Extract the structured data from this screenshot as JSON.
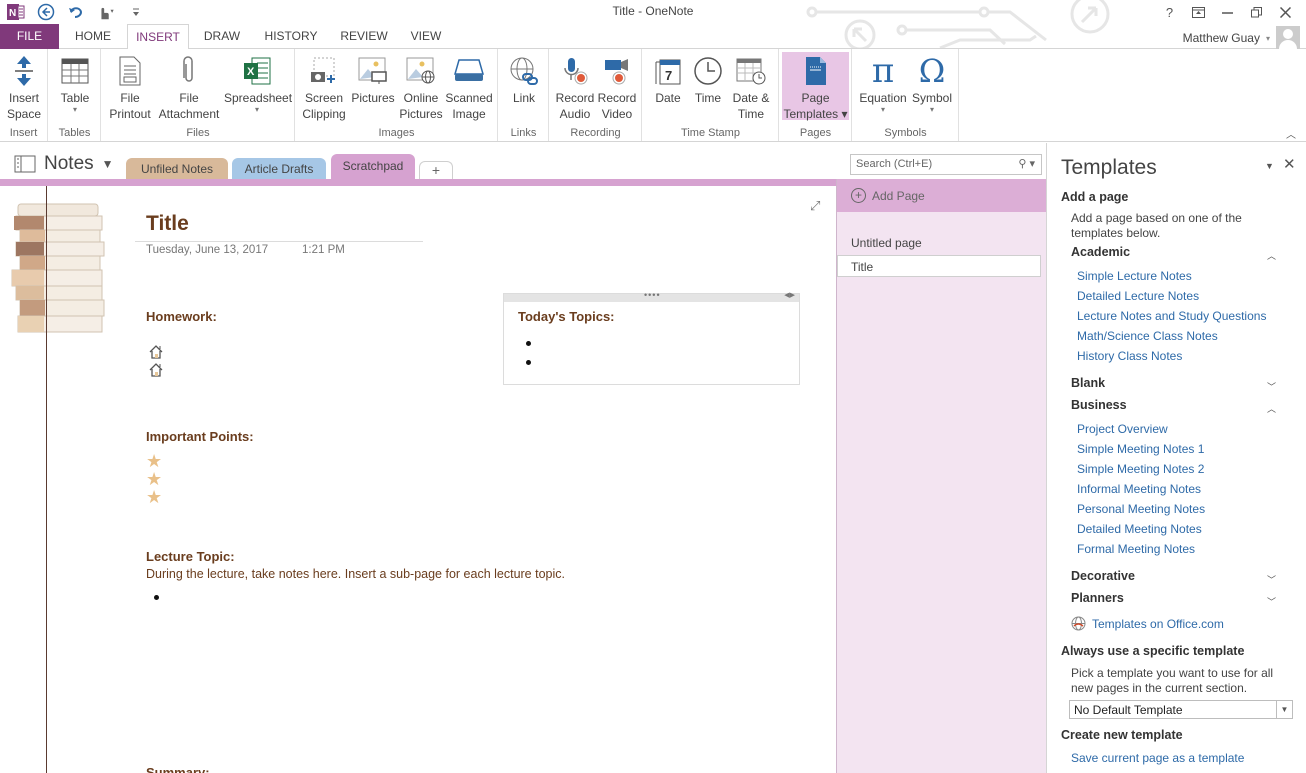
{
  "window": {
    "title": "Title - OneNote",
    "controls": {
      "help": "?",
      "ribbon_display": "ribbon-display-icon",
      "minimize": "minimize-icon",
      "restore": "restore-icon",
      "close": "close-icon"
    }
  },
  "quick_access": [
    "onenote-logo-icon",
    "back-icon",
    "undo-icon",
    "touch-mode-icon",
    "customize-qat-icon"
  ],
  "tabs": [
    {
      "label": "FILE"
    },
    {
      "label": "HOME"
    },
    {
      "label": "INSERT",
      "active": true
    },
    {
      "label": "DRAW"
    },
    {
      "label": "HISTORY"
    },
    {
      "label": "REVIEW"
    },
    {
      "label": "VIEW"
    }
  ],
  "user": {
    "name": "Matthew Guay"
  },
  "ribbon": {
    "groups": [
      {
        "label": "Insert",
        "buttons": [
          {
            "l1": "Insert",
            "l2": "Space"
          }
        ]
      },
      {
        "label": "Tables",
        "buttons": [
          {
            "l1": "Table",
            "dropdown": true
          }
        ]
      },
      {
        "label": "Files",
        "buttons": [
          {
            "l1": "File",
            "l2": "Printout"
          },
          {
            "l1": "File",
            "l2": "Attachment"
          },
          {
            "l1": "Spreadsheet",
            "dropdown": true
          }
        ]
      },
      {
        "label": "Images",
        "buttons": [
          {
            "l1": "Screen",
            "l2": "Clipping"
          },
          {
            "l1": "Pictures"
          },
          {
            "l1": "Online",
            "l2": "Pictures"
          },
          {
            "l1": "Scanned",
            "l2": "Image"
          }
        ]
      },
      {
        "label": "Links",
        "buttons": [
          {
            "l1": "Link"
          }
        ]
      },
      {
        "label": "Recording",
        "buttons": [
          {
            "l1": "Record",
            "l2": "Audio"
          },
          {
            "l1": "Record",
            "l2": "Video"
          }
        ]
      },
      {
        "label": "Time Stamp",
        "buttons": [
          {
            "l1": "Date"
          },
          {
            "l1": "Time"
          },
          {
            "l1": "Date &",
            "l2": "Time"
          }
        ]
      },
      {
        "label": "Pages",
        "buttons": [
          {
            "l1": "Page",
            "l2": "Templates ▾",
            "selected": true
          }
        ]
      },
      {
        "label": "Symbols",
        "buttons": [
          {
            "l1": "Equation",
            "dropdown": true
          },
          {
            "l1": "Symbol",
            "dropdown": true
          }
        ]
      }
    ]
  },
  "notebook": {
    "name": "Notes",
    "sections": [
      {
        "label": "Unfiled Notes",
        "color": "#d8b99a"
      },
      {
        "label": "Article Drafts",
        "color": "#a6c7e6"
      },
      {
        "label": "Scratchpad",
        "color": "#d6a2d0",
        "active": true
      }
    ],
    "add_section": "+"
  },
  "search": {
    "placeholder": "Search (Ctrl+E)"
  },
  "page": {
    "title": "Title",
    "date": "Tuesday, June 13, 2017",
    "time": "1:21 PM",
    "homework_heading": "Homework:",
    "homework_items": 2,
    "topics_heading": "Today's Topics:",
    "topics_bullets": 2,
    "important_heading": "Important Points:",
    "important_items": 3,
    "lecture_heading": "Lecture Topic:",
    "lecture_text": "During the lecture, take notes here.  Insert a sub-page for each lecture topic.",
    "summary_heading": "Summary:"
  },
  "pages_panel": {
    "add_page": "Add Page",
    "pages": [
      {
        "label": "Untitled page"
      },
      {
        "label": "Title",
        "current": true
      }
    ]
  },
  "templates_pane": {
    "title": "Templates",
    "add_a_page": "Add a page",
    "add_desc_1": "Add a page based on one of the",
    "add_desc_2": "templates below.",
    "categories": [
      {
        "name": "Academic",
        "expanded": true,
        "items": [
          "Simple Lecture Notes",
          "Detailed Lecture Notes",
          "Lecture Notes and Study Questions",
          "Math/Science Class Notes",
          "History Class Notes"
        ]
      },
      {
        "name": "Blank",
        "expanded": false,
        "items": []
      },
      {
        "name": "Business",
        "expanded": true,
        "items": [
          "Project Overview",
          "Simple Meeting Notes 1",
          "Simple Meeting Notes 2",
          "Informal Meeting Notes",
          "Personal Meeting Notes",
          "Detailed Meeting Notes",
          "Formal Meeting Notes"
        ]
      },
      {
        "name": "Decorative",
        "expanded": false,
        "items": []
      },
      {
        "name": "Planners",
        "expanded": false,
        "items": []
      }
    ],
    "office_link": "Templates on Office.com",
    "always_heading": "Always use a specific template",
    "always_desc_1": "Pick a template you want to use for all",
    "always_desc_2": "new pages in the current section.",
    "default_select": "No Default Template",
    "create_heading": "Create new template",
    "save_link": "Save current page as a template"
  }
}
